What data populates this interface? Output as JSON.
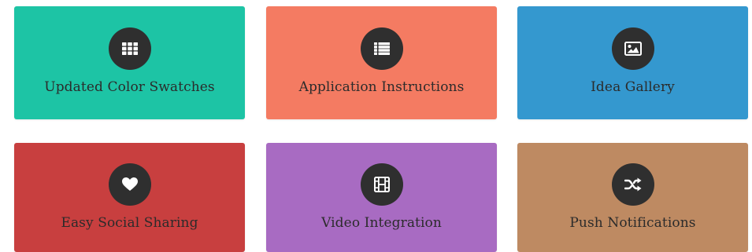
{
  "tiles": [
    {
      "label": "Updated Color Swatches",
      "icon": "grid-icon",
      "color": "#1dc4a5"
    },
    {
      "label": "Application Instructions",
      "icon": "list-icon",
      "color": "#f47b62"
    },
    {
      "label": "Idea Gallery",
      "icon": "image-icon",
      "color": "#3498cf"
    },
    {
      "label": "Easy Social Sharing",
      "icon": "heart-icon",
      "color": "#c83f3f"
    },
    {
      "label": "Video Integration",
      "icon": "film-icon",
      "color": "#a86bc2"
    },
    {
      "label": "Push Notifications",
      "icon": "shuffle-icon",
      "color": "#be8a62"
    }
  ]
}
